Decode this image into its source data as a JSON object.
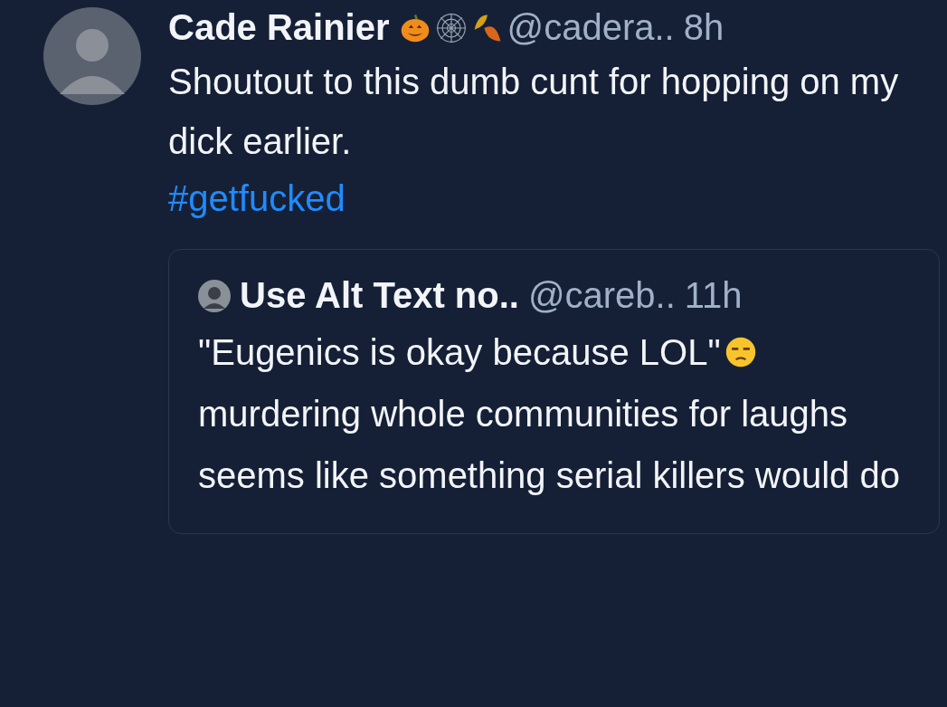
{
  "post": {
    "author": {
      "display_name": "Cade Rainier",
      "handle": "@cadera..",
      "time": "8h"
    },
    "text": "Shoutout to this dumb cunt for hopping on my dick earlier.",
    "hashtag": "#getfucked",
    "quote": {
      "author": {
        "display_name": "Use Alt Text no..",
        "handle": "@careb..",
        "time": "11h"
      },
      "text_before": "\"Eugenics is okay because LOL\"",
      "text_after": "murdering whole communities for laughs seems like something serial killers would do"
    }
  }
}
